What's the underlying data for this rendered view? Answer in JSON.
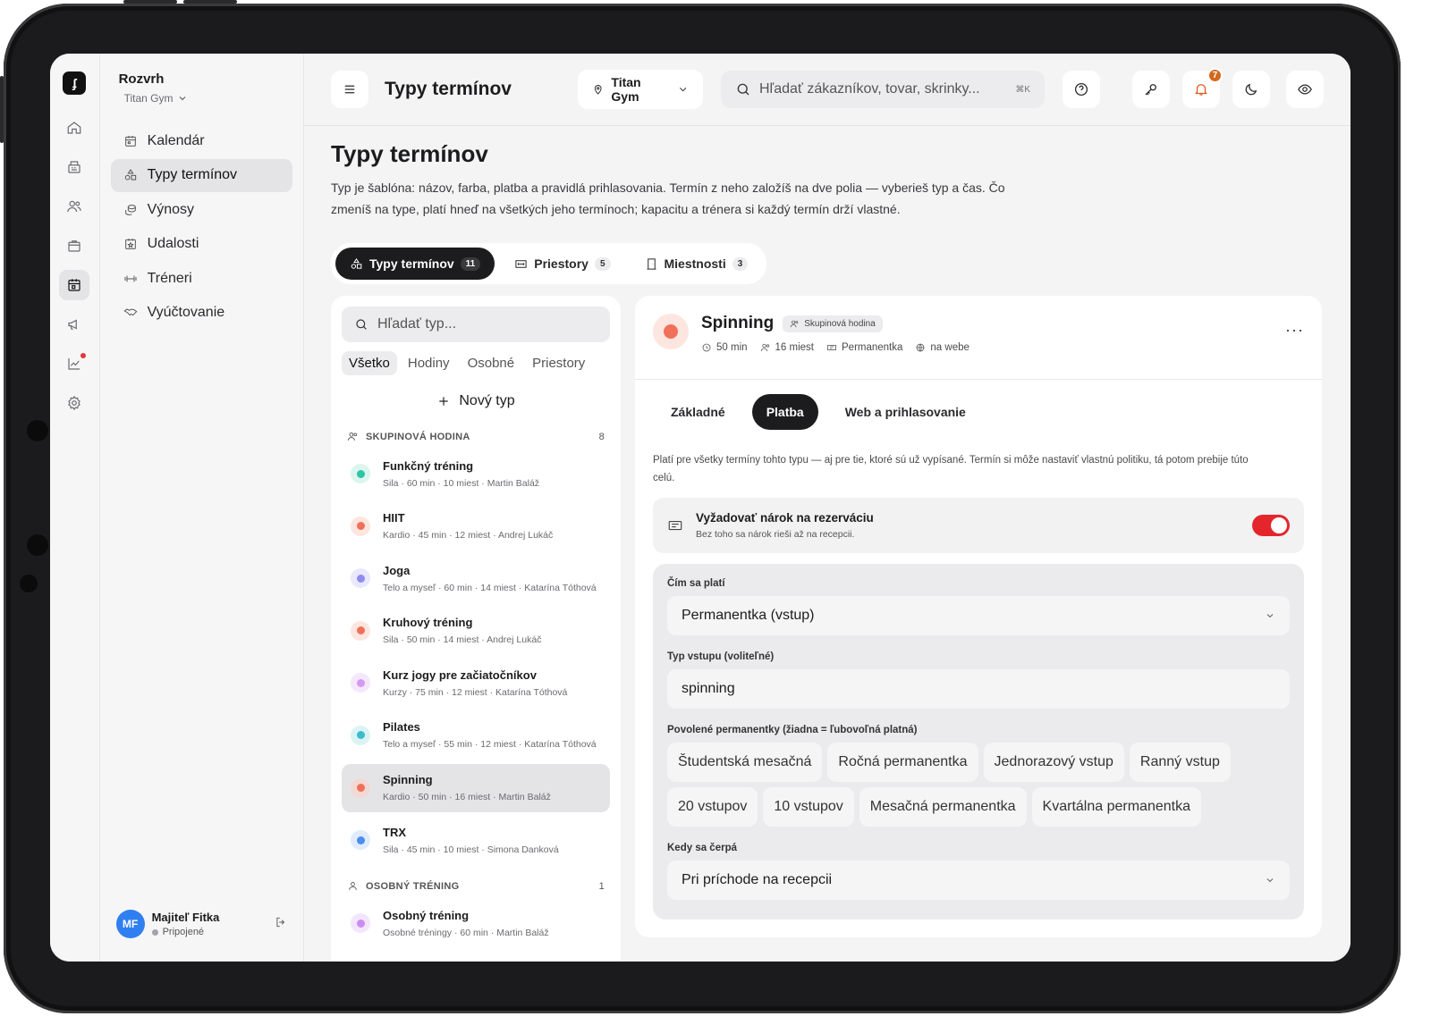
{
  "sidebar": {
    "title": "Rozvrh",
    "gym": "Titan Gym",
    "items": [
      {
        "label": "Kalendár"
      },
      {
        "label": "Typy termínov"
      },
      {
        "label": "Výnosy"
      },
      {
        "label": "Udalosti"
      },
      {
        "label": "Tréneri"
      },
      {
        "label": "Vyúčtovanie"
      }
    ],
    "user": {
      "initials": "MF",
      "name": "Majiteľ Fitka",
      "status": "Pripojené"
    }
  },
  "topbar": {
    "title": "Typy termínov",
    "gym": "Titan Gym",
    "search_placeholder": "Hľadať zákazníkov, tovar, skrinky...",
    "shortcut": "⌘K",
    "notifications": "7"
  },
  "page": {
    "title": "Typy termínov",
    "description": "Typ je šablóna: názov, farba, platba a pravidlá prihlasovania. Termín z neho založíš na dve polia — vyberieš typ a čas. Čo zmeníš na type, platí hneď na všetkých jeho termínoch; kapacitu a trénera si každý termín drží vlastné."
  },
  "segments": [
    {
      "label": "Typy termínov",
      "count": "11"
    },
    {
      "label": "Priestory",
      "count": "5"
    },
    {
      "label": "Miestnosti",
      "count": "3"
    }
  ],
  "list": {
    "search_placeholder": "Hľadať typ...",
    "filters": [
      "Všetko",
      "Hodiny",
      "Osobné",
      "Priestory"
    ],
    "new_label": "Nový typ",
    "groups": [
      {
        "title": "SKUPINOVÁ HODINA",
        "count": "8",
        "items": [
          {
            "name": "Funkčný tréning",
            "meta": "Sila · 60 min · 10 miest · Martin Baláž",
            "color": "#2ec4a5",
            "tint": "#dcf5ee"
          },
          {
            "name": "HIIT",
            "meta": "Kardio · 45 min · 12 miest · Andrej Lukáč",
            "color": "#f0705a",
            "tint": "#fde6df"
          },
          {
            "name": "Joga",
            "meta": "Telo a myseľ · 60 min · 14 miest · Katarína Tóthová",
            "color": "#8e8cf0",
            "tint": "#e9e8fc"
          },
          {
            "name": "Kruhový tréning",
            "meta": "Sila · 50 min · 14 miest · Andrej Lukáč",
            "color": "#f0705a",
            "tint": "#fde6df"
          },
          {
            "name": "Kurz jogy pre začiatočníkov",
            "meta": "Kurzy · 75 min · 12 miest · Katarína Tóthová",
            "color": "#d49af0",
            "tint": "#f5e8fc"
          },
          {
            "name": "Pilates",
            "meta": "Telo a myseľ · 55 min · 12 miest · Katarína Tóthová",
            "color": "#3cbccb",
            "tint": "#dcf3f6"
          },
          {
            "name": "Spinning",
            "meta": "Kardio · 50 min · 16 miest · Martin Baláž",
            "color": "#f0705a",
            "tint": "#f3d9d3"
          },
          {
            "name": "TRX",
            "meta": "Sila · 45 min · 10 miest · Simona Danková",
            "color": "#4a8ef0",
            "tint": "#e0ecfd"
          }
        ]
      },
      {
        "title": "OSOBNÝ TRÉNING",
        "count": "1",
        "items": [
          {
            "name": "Osobný tréning",
            "meta": "Osobné tréningy · 60 min · Martin Baláž",
            "color": "#c98cf0",
            "tint": "#f3e6fc"
          }
        ]
      }
    ]
  },
  "detail": {
    "name": "Spinning",
    "chip": "Skupinová hodina",
    "meta": [
      "50 min",
      "16 miest",
      "Permanentka",
      "na webe"
    ],
    "tabs": [
      "Základné",
      "Platba",
      "Web a prihlasovanie"
    ],
    "note": "Platí pre všetky termíny tohto typu — aj pre tie, ktoré sú už vypísané. Termín si môže nastaviť vlastnú politiku, tá potom prebije túto celú.",
    "require": {
      "title": "Vyžadovať nárok na rezerváciu",
      "sub": "Bez toho sa nárok rieši až na recepcii.",
      "enabled": true
    },
    "pay_label": "Čím sa platí",
    "pay_value": "Permanentka (vstup)",
    "entry_label": "Typ vstupu (voliteľné)",
    "entry_value": "spinning",
    "allowed_label": "Povolené permanentky (žiadna = ľubovoľná platná)",
    "allowed": [
      "Študentská mesačná",
      "Ročná permanentka",
      "Jednorazový vstup",
      "Ranný vstup",
      "20 vstupov",
      "10 vstupov",
      "Mesačná permanentka",
      "Kvartálna permanentka"
    ],
    "when_label": "Kedy sa čerpá",
    "when_value": "Pri príchode na recepcii"
  }
}
